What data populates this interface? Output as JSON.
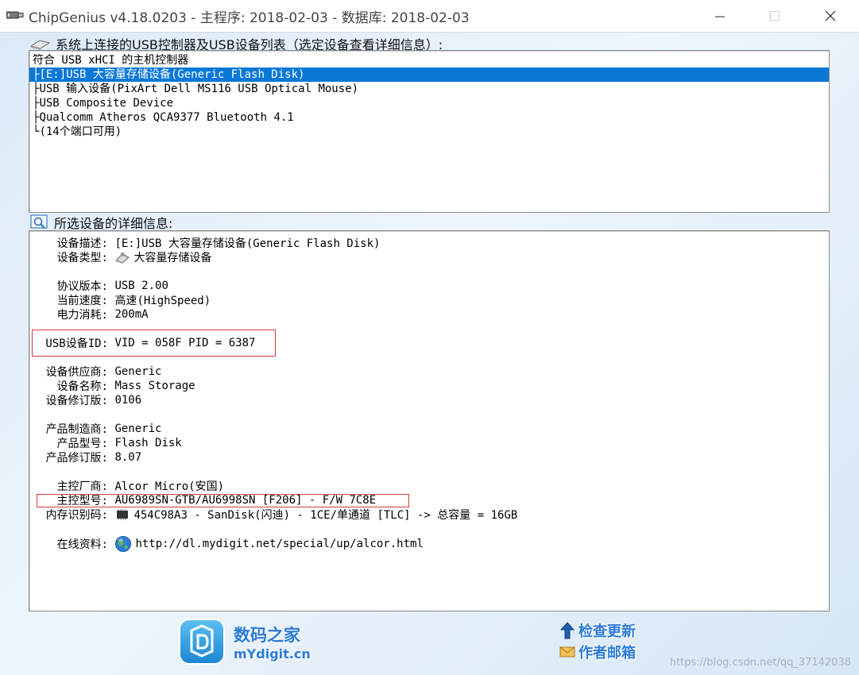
{
  "window": {
    "title": "ChipGenius v4.18.0203 - 主程序: 2018-02-03 - 数据库: 2018-02-03"
  },
  "device_list": {
    "label": "系统上连接的USB控制器及USB设备列表（选定设备查看详细信息）:",
    "items": [
      {
        "text": "符合 USB xHCI 的主机控制器",
        "prefix": ""
      },
      {
        "text": "[E:]USB 大容量存储设备(Generic Flash Disk)",
        "prefix": "├",
        "selected": true
      },
      {
        "text": "USB 输入设备(PixArt Dell MS116 USB Optical Mouse)",
        "prefix": "├"
      },
      {
        "text": "USB Composite Device",
        "prefix": "├"
      },
      {
        "text": "Qualcomm Atheros QCA9377 Bluetooth 4.1",
        "prefix": "├"
      },
      {
        "text": "(14个端口可用)",
        "prefix": "└"
      }
    ]
  },
  "details": {
    "label": "所选设备的详细信息:",
    "desc_label": "设备描述:",
    "desc_value": "[E:]USB 大容量存储设备(Generic Flash Disk)",
    "type_label": "设备类型:",
    "type_value": "大容量存储设备",
    "protocol_label": "协议版本:",
    "protocol_value": "USB 2.00",
    "speed_label": "当前速度:",
    "speed_value": "高速(HighSpeed)",
    "power_label": "电力消耗:",
    "power_value": "200mA",
    "usbid_label": "USB设备ID:",
    "usbid_value": "VID = 058F PID = 6387",
    "vendor_label": "设备供应商:",
    "vendor_value": "Generic",
    "devname_label": "设备名称:",
    "devname_value": "Mass Storage",
    "devrev_label": "设备修订版:",
    "devrev_value": "0106",
    "mfr_label": "产品制造商:",
    "mfr_value": "Generic",
    "model_label": "产品型号:",
    "model_value": "Flash Disk",
    "prodrev_label": "产品修订版:",
    "prodrev_value": "8.07",
    "ctrl_vendor_label": "主控厂商:",
    "ctrl_vendor_value": "Alcor Micro(安国)",
    "ctrl_model_label": "主控型号:",
    "ctrl_model_value": "AU6989SN-GTB/AU6998SN [F206] - F/W 7C8E",
    "flash_label": "内存识别码:",
    "flash_value": "454C98A3 - SanDisk(闪迪) - 1CE/单通道 [TLC] -> 总容量 = 16GB",
    "online_label": "在线资料:",
    "online_value": "http://dl.mydigit.net/special/up/alcor.html"
  },
  "footer": {
    "logo_cn": "数码之家",
    "logo_en": "mYdigit.cn",
    "check_update": "检查更新",
    "author_mail": "作者邮箱",
    "watermark": "https://blog.csdn.net/qq_37142038"
  },
  "colors": {
    "selection": "#0a78d7",
    "highlight_box": "#d43a3a",
    "link_blue": "#2d7bd6"
  }
}
